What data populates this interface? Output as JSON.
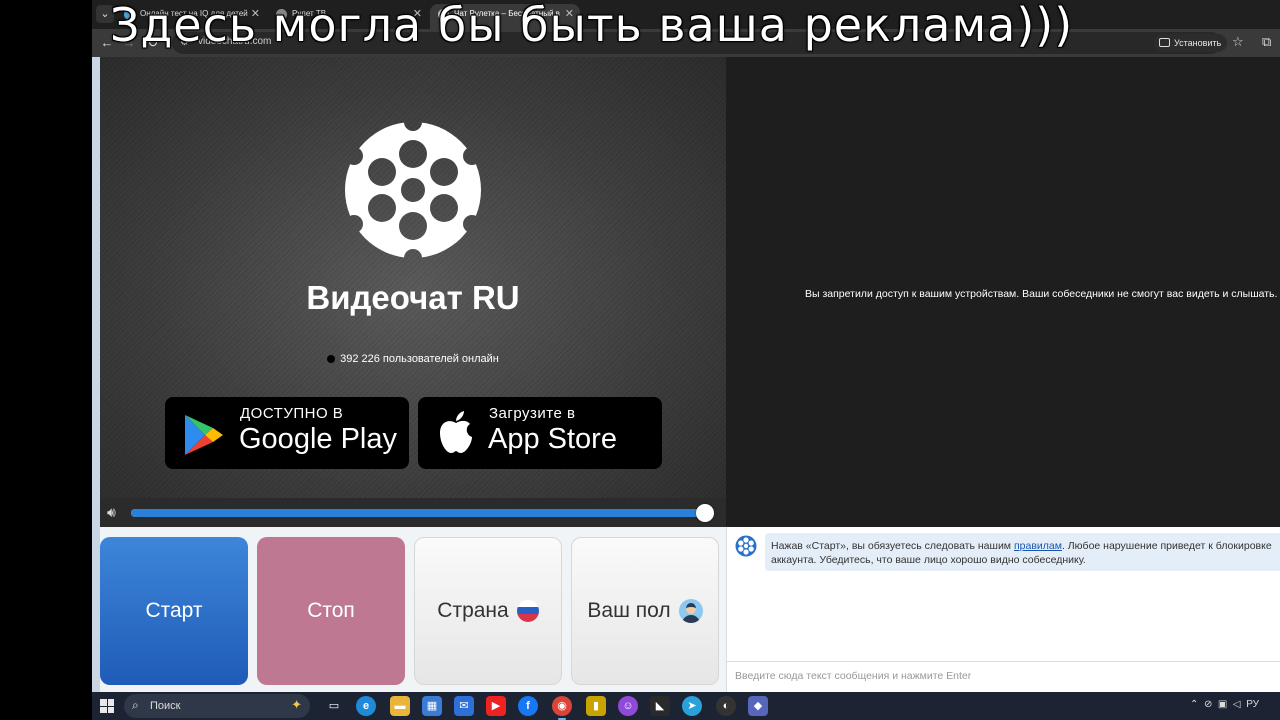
{
  "caption": "Здесь могла бы быть ваша реклама)))",
  "browser": {
    "tabs": [
      {
        "title": "Онлайн тест на IQ для детей",
        "active": false
      },
      {
        "title": "Рулет ТВ",
        "active": false
      },
      {
        "title": "Чат Рулетка – Бесплатный в",
        "active": true
      }
    ],
    "url": "videochatru.com",
    "install_label": "Установить"
  },
  "video": {
    "brand": "Видеочат RU",
    "online_text": "392 226 пользователей онлайн",
    "google_play": {
      "small": "ДОСТУПНО В",
      "big": "Google Play"
    },
    "app_store": {
      "small": "Загрузите в",
      "big": "App Store"
    },
    "volume_level": 0.99
  },
  "peer": {
    "message": "Вы запретили доступ к вашим устройствам. Ваши собеседники не смогут вас видеть и слышать."
  },
  "controls": {
    "start": "Старт",
    "stop": "Стоп",
    "country": "Страна",
    "gender": "Ваш пол"
  },
  "chat": {
    "system_before": "Нажав «Старт», вы обязуетесь следовать нашим ",
    "system_link": "правилам",
    "system_after": ". Любое нарушение приведет к блокировке",
    "system_line2": "аккаунта. Убедитесь, что ваше лицо хорошо видно собеседнику.",
    "placeholder": "Введите сюда текст сообщения и нажмите Enter"
  },
  "taskbar": {
    "search_label": "Поиск",
    "lang": "РУ"
  },
  "colors": {
    "start": "#2a6fcc",
    "stop": "#bf7891",
    "volume": "#2a80d8"
  }
}
